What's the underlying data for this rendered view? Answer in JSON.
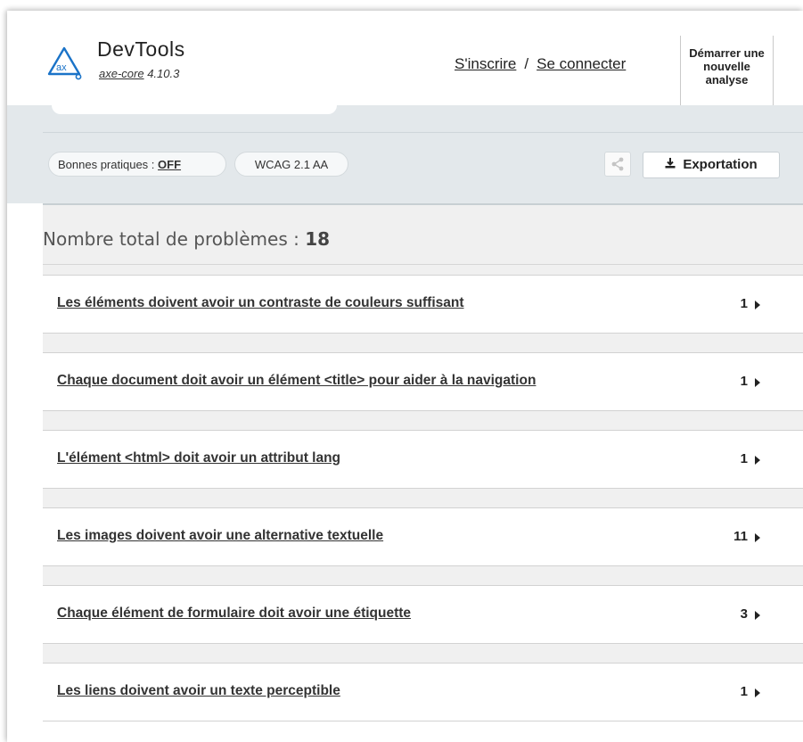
{
  "header": {
    "app_title": "DevTools",
    "version_link": "axe-core",
    "version_number": "4.10.3",
    "signup_label": "S'inscrire",
    "separator": "/",
    "login_label": "Se connecter",
    "new_analysis_label": "Démarrer une nouvelle analyse"
  },
  "toolbar": {
    "best_practices_label": "Bonnes pratiques :",
    "best_practices_value": "OFF",
    "standard_label": "WCAG 2.1 AA",
    "share_icon": "share-icon",
    "export_icon": "download-icon",
    "export_label": "Exportation"
  },
  "summary": {
    "total_label": "Nombre total de problèmes :",
    "total_count": "18"
  },
  "issues": [
    {
      "title": "Les éléments doivent avoir un contraste de couleurs suffisant",
      "count": "1"
    },
    {
      "title": "Chaque document doit avoir un élément <title> pour aider à la navigation",
      "count": "1"
    },
    {
      "title": "L'élément <html> doit avoir un attribut lang",
      "count": "1"
    },
    {
      "title": "Les images doivent avoir une alternative textuelle",
      "count": "11"
    },
    {
      "title": "Chaque élément de formulaire doit avoir une étiquette",
      "count": "3"
    },
    {
      "title": "Les liens doivent avoir un texte perceptible",
      "count": "1"
    }
  ],
  "colors": {
    "toolbar_bg": "#e3e8eb",
    "summary_bg": "#f0f0f0",
    "logo_blue": "#1a73c8"
  }
}
